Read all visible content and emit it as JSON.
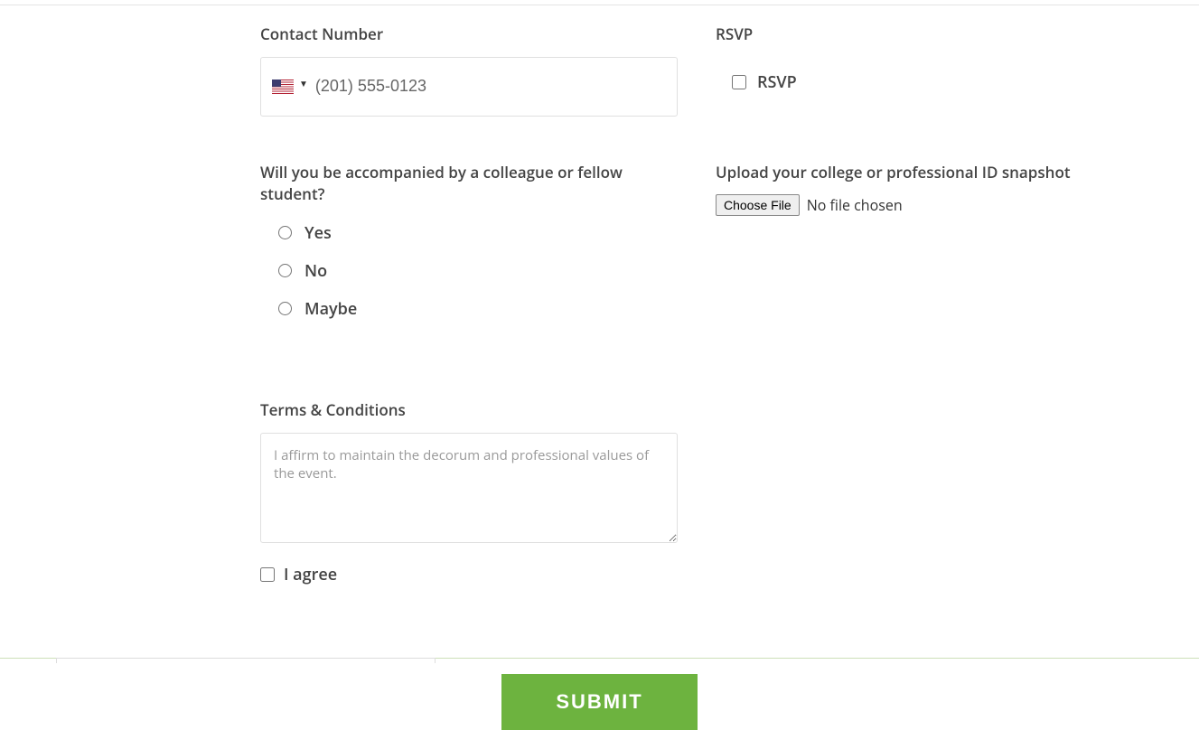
{
  "contact": {
    "label": "Contact Number",
    "placeholder": "(201) 555-0123"
  },
  "rsvp": {
    "label": "RSVP",
    "option_label": "RSVP"
  },
  "accompanied": {
    "label": "Will you be accompanied by a colleague or fellow student?",
    "options": [
      "Yes",
      "No",
      "Maybe"
    ]
  },
  "upload": {
    "label": "Upload your college or professional ID snapshot",
    "button": "Choose File",
    "status": "No file chosen"
  },
  "terms": {
    "label": "Terms & Conditions",
    "placeholder": "I affirm to maintain the decorum and professional values of the event.",
    "agree_label": "I agree"
  },
  "submit": {
    "label": "SUBMIT"
  }
}
